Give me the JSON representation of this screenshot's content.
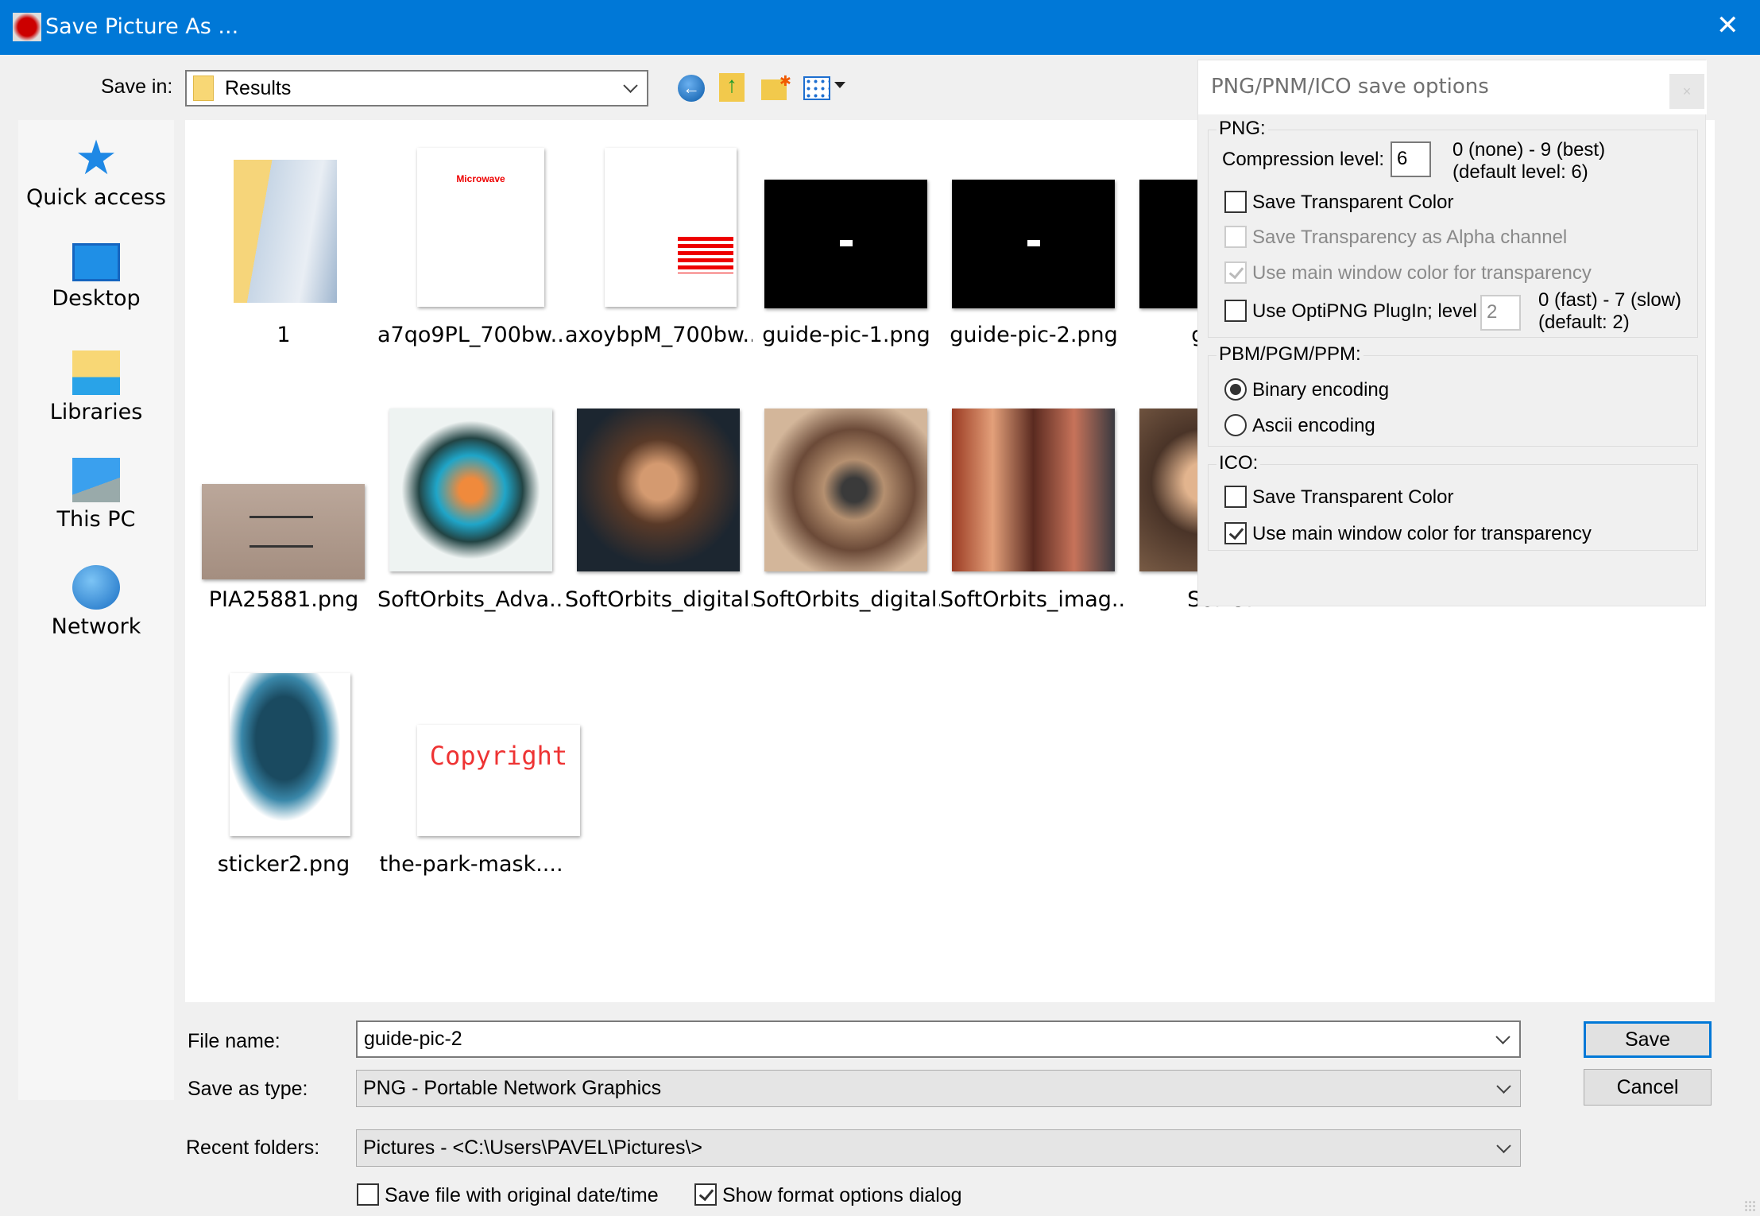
{
  "window": {
    "title": "Save Picture As ...",
    "close_icon": "close-icon"
  },
  "toolbar": {
    "save_in_label": "Save in:",
    "save_in_value": "Results",
    "icons": [
      "back-icon",
      "up-folder-icon",
      "new-folder-icon",
      "view-menu-icon"
    ]
  },
  "places": [
    {
      "label": "Quick access",
      "icon": "star-icon"
    },
    {
      "label": "Desktop",
      "icon": "desktop-icon"
    },
    {
      "label": "Libraries",
      "icon": "libraries-icon"
    },
    {
      "label": "This PC",
      "icon": "computer-icon"
    },
    {
      "label": "Network",
      "icon": "network-icon"
    }
  ],
  "files": [
    {
      "name": "1",
      "kind": "folder"
    },
    {
      "name": "a7qo9PL_700bw...",
      "kind": "white-red-top"
    },
    {
      "name": "axoybpM_700bw...",
      "kind": "white-red-bottom"
    },
    {
      "name": "guide-pic-1.png",
      "kind": "black"
    },
    {
      "name": "guide-pic-2.png",
      "kind": "black"
    },
    {
      "name": "guide",
      "kind": "black"
    },
    {
      "name": "PIA25881.png",
      "kind": "mars"
    },
    {
      "name": "SoftOrbits_Adva...",
      "kind": "head"
    },
    {
      "name": "SoftOrbits_digital...",
      "kind": "boy"
    },
    {
      "name": "SoftOrbits_digital...",
      "kind": "eye"
    },
    {
      "name": "SoftOrbits_imag...",
      "kind": "redhead"
    },
    {
      "name": "SoftOr",
      "kind": "girl"
    },
    {
      "name": "sticker2.png",
      "kind": "silhouette"
    },
    {
      "name": "the-park-mask....",
      "kind": "copyright",
      "thumb_text": "Copyright"
    }
  ],
  "thumb_texts": {
    "microwave": "Microwave"
  },
  "bottom": {
    "file_name_label": "File name:",
    "file_name_value": "guide-pic-2",
    "type_label": "Save as type:",
    "type_value": "PNG - Portable Network Graphics",
    "recent_label": "Recent folders:",
    "recent_value": "Pictures  -  <C:\\Users\\PAVEL\\Pictures\\>",
    "save": "Save",
    "cancel": "Cancel",
    "orig_date_label": "Save file with original date/time",
    "orig_date_checked": false,
    "show_options_label": "Show format options dialog",
    "show_options_checked": true
  },
  "options": {
    "title": "PNG/PNM/ICO save options",
    "close": "×",
    "png_group": "PNG:",
    "compression_label": "Compression level:",
    "compression_value": "6",
    "compression_range": "0 (none) - 9 (best)",
    "compression_default": "(default level: 6)",
    "save_transparent": "Save Transparent Color",
    "save_transparent_checked": false,
    "alpha": "Save Transparency as Alpha channel",
    "alpha_checked": false,
    "use_main": "Use main window color for transparency",
    "use_main_checked": true,
    "optipng": "Use OptiPNG PlugIn; level",
    "optipng_checked": false,
    "optipng_value": "2",
    "optipng_range": "0 (fast) - 7 (slow)",
    "optipng_default": "(default: 2)",
    "pnm_group": "PBM/PGM/PPM:",
    "binary": "Binary encoding",
    "binary_selected": true,
    "ascii": "Ascii encoding",
    "ascii_selected": false,
    "ico_group": "ICO:",
    "ico_transparent": "Save Transparent Color",
    "ico_transparent_checked": false,
    "ico_use_main": "Use main window color for transparency",
    "ico_use_main_checked": true
  },
  "colors": {
    "titlebar": "#0078d7",
    "accent": "#0078d7"
  }
}
